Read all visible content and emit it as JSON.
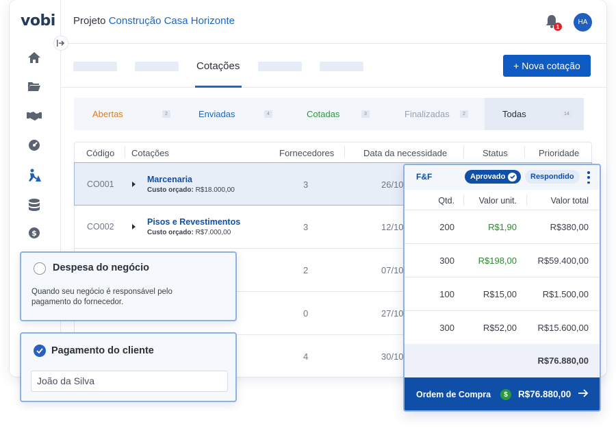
{
  "app": {
    "logo": "vobi"
  },
  "header": {
    "project_label": "Projeto",
    "project_name": "Construção Casa Horizonte",
    "notification_count": "1",
    "avatar_initials": "HA"
  },
  "tabs": {
    "active_label": "Cotações",
    "new_button": "+ Nova cotação"
  },
  "filters": [
    {
      "label": "Abertas",
      "count": "2",
      "color": "#e07a1f"
    },
    {
      "label": "Enviadas",
      "count": "4",
      "color": "#1f66c1"
    },
    {
      "label": "Cotadas",
      "count": "3",
      "color": "#2c9a3c"
    },
    {
      "label": "Finalizadas",
      "count": "2",
      "color": "#9aa1ad"
    },
    {
      "label": "Todas",
      "count": "14",
      "color": "#2a2f3a"
    }
  ],
  "table": {
    "headers": [
      "Código",
      "Cotações",
      "Fornecedores",
      "Data da necessidade",
      "Status",
      "Prioridade"
    ],
    "rows": [
      {
        "code": "CO001",
        "name": "Marcenaria",
        "budget_label": "Custo orçado:",
        "budget": "R$18.000,00",
        "suppliers": "3",
        "date": "26/10"
      },
      {
        "code": "CO002",
        "name": "Pisos e Revestimentos",
        "budget_label": "Custo orçado:",
        "budget": "R$7.000,00",
        "suppliers": "3",
        "date": "12/10"
      },
      {
        "suppliers": "2",
        "date": "07/10"
      },
      {
        "suppliers": "0",
        "date": "27/10"
      },
      {
        "suppliers": "4",
        "date": "30/10"
      }
    ]
  },
  "card_expense": {
    "title": "Despesa do negócio",
    "description": "Quando seu negócio é responsável pelo pagamento do fornecedor."
  },
  "card_client": {
    "title": "Pagamento do cliente",
    "input_value": "João da Silva"
  },
  "panel": {
    "supplier": "F&F",
    "badge_approved": "Aprovado",
    "badge_responded": "Respondido",
    "columns": [
      "Qtd.",
      "Valor unit.",
      "Valor total"
    ],
    "items": [
      {
        "qty": "200",
        "unit": "R$1,90",
        "total": "R$380,00",
        "unit_green": true
      },
      {
        "qty": "300",
        "unit": "R$198,00",
        "total": "R$59.400,00",
        "unit_green": true
      },
      {
        "qty": "100",
        "unit": "R$15,00",
        "total": "R$1.500,00",
        "unit_green": false
      },
      {
        "qty": "300",
        "unit": "R$52,00",
        "total": "R$15.600,00",
        "unit_green": false
      }
    ],
    "total": "R$76.880,00",
    "footer_label": "Ordem de Compra",
    "footer_amount": "R$76.880,00"
  }
}
